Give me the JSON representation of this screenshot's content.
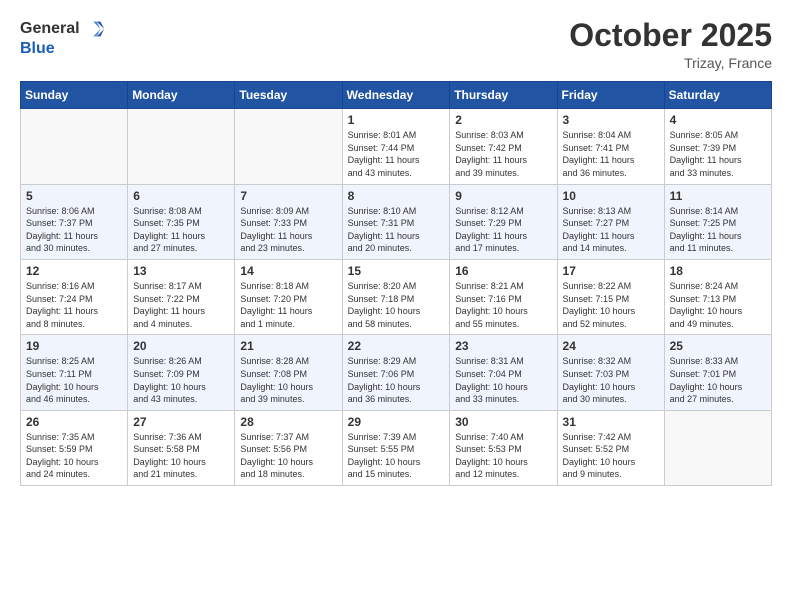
{
  "header": {
    "logo": {
      "general": "General",
      "blue": "Blue"
    },
    "title": "October 2025",
    "location": "Trizay, France"
  },
  "weekdays": [
    "Sunday",
    "Monday",
    "Tuesday",
    "Wednesday",
    "Thursday",
    "Friday",
    "Saturday"
  ],
  "weeks": [
    [
      {
        "day": "",
        "info": ""
      },
      {
        "day": "",
        "info": ""
      },
      {
        "day": "",
        "info": ""
      },
      {
        "day": "1",
        "info": "Sunrise: 8:01 AM\nSunset: 7:44 PM\nDaylight: 11 hours\nand 43 minutes."
      },
      {
        "day": "2",
        "info": "Sunrise: 8:03 AM\nSunset: 7:42 PM\nDaylight: 11 hours\nand 39 minutes."
      },
      {
        "day": "3",
        "info": "Sunrise: 8:04 AM\nSunset: 7:41 PM\nDaylight: 11 hours\nand 36 minutes."
      },
      {
        "day": "4",
        "info": "Sunrise: 8:05 AM\nSunset: 7:39 PM\nDaylight: 11 hours\nand 33 minutes."
      }
    ],
    [
      {
        "day": "5",
        "info": "Sunrise: 8:06 AM\nSunset: 7:37 PM\nDaylight: 11 hours\nand 30 minutes."
      },
      {
        "day": "6",
        "info": "Sunrise: 8:08 AM\nSunset: 7:35 PM\nDaylight: 11 hours\nand 27 minutes."
      },
      {
        "day": "7",
        "info": "Sunrise: 8:09 AM\nSunset: 7:33 PM\nDaylight: 11 hours\nand 23 minutes."
      },
      {
        "day": "8",
        "info": "Sunrise: 8:10 AM\nSunset: 7:31 PM\nDaylight: 11 hours\nand 20 minutes."
      },
      {
        "day": "9",
        "info": "Sunrise: 8:12 AM\nSunset: 7:29 PM\nDaylight: 11 hours\nand 17 minutes."
      },
      {
        "day": "10",
        "info": "Sunrise: 8:13 AM\nSunset: 7:27 PM\nDaylight: 11 hours\nand 14 minutes."
      },
      {
        "day": "11",
        "info": "Sunrise: 8:14 AM\nSunset: 7:25 PM\nDaylight: 11 hours\nand 11 minutes."
      }
    ],
    [
      {
        "day": "12",
        "info": "Sunrise: 8:16 AM\nSunset: 7:24 PM\nDaylight: 11 hours\nand 8 minutes."
      },
      {
        "day": "13",
        "info": "Sunrise: 8:17 AM\nSunset: 7:22 PM\nDaylight: 11 hours\nand 4 minutes."
      },
      {
        "day": "14",
        "info": "Sunrise: 8:18 AM\nSunset: 7:20 PM\nDaylight: 11 hours\nand 1 minute."
      },
      {
        "day": "15",
        "info": "Sunrise: 8:20 AM\nSunset: 7:18 PM\nDaylight: 10 hours\nand 58 minutes."
      },
      {
        "day": "16",
        "info": "Sunrise: 8:21 AM\nSunset: 7:16 PM\nDaylight: 10 hours\nand 55 minutes."
      },
      {
        "day": "17",
        "info": "Sunrise: 8:22 AM\nSunset: 7:15 PM\nDaylight: 10 hours\nand 52 minutes."
      },
      {
        "day": "18",
        "info": "Sunrise: 8:24 AM\nSunset: 7:13 PM\nDaylight: 10 hours\nand 49 minutes."
      }
    ],
    [
      {
        "day": "19",
        "info": "Sunrise: 8:25 AM\nSunset: 7:11 PM\nDaylight: 10 hours\nand 46 minutes."
      },
      {
        "day": "20",
        "info": "Sunrise: 8:26 AM\nSunset: 7:09 PM\nDaylight: 10 hours\nand 43 minutes."
      },
      {
        "day": "21",
        "info": "Sunrise: 8:28 AM\nSunset: 7:08 PM\nDaylight: 10 hours\nand 39 minutes."
      },
      {
        "day": "22",
        "info": "Sunrise: 8:29 AM\nSunset: 7:06 PM\nDaylight: 10 hours\nand 36 minutes."
      },
      {
        "day": "23",
        "info": "Sunrise: 8:31 AM\nSunset: 7:04 PM\nDaylight: 10 hours\nand 33 minutes."
      },
      {
        "day": "24",
        "info": "Sunrise: 8:32 AM\nSunset: 7:03 PM\nDaylight: 10 hours\nand 30 minutes."
      },
      {
        "day": "25",
        "info": "Sunrise: 8:33 AM\nSunset: 7:01 PM\nDaylight: 10 hours\nand 27 minutes."
      }
    ],
    [
      {
        "day": "26",
        "info": "Sunrise: 7:35 AM\nSunset: 5:59 PM\nDaylight: 10 hours\nand 24 minutes."
      },
      {
        "day": "27",
        "info": "Sunrise: 7:36 AM\nSunset: 5:58 PM\nDaylight: 10 hours\nand 21 minutes."
      },
      {
        "day": "28",
        "info": "Sunrise: 7:37 AM\nSunset: 5:56 PM\nDaylight: 10 hours\nand 18 minutes."
      },
      {
        "day": "29",
        "info": "Sunrise: 7:39 AM\nSunset: 5:55 PM\nDaylight: 10 hours\nand 15 minutes."
      },
      {
        "day": "30",
        "info": "Sunrise: 7:40 AM\nSunset: 5:53 PM\nDaylight: 10 hours\nand 12 minutes."
      },
      {
        "day": "31",
        "info": "Sunrise: 7:42 AM\nSunset: 5:52 PM\nDaylight: 10 hours\nand 9 minutes."
      },
      {
        "day": "",
        "info": ""
      }
    ]
  ]
}
